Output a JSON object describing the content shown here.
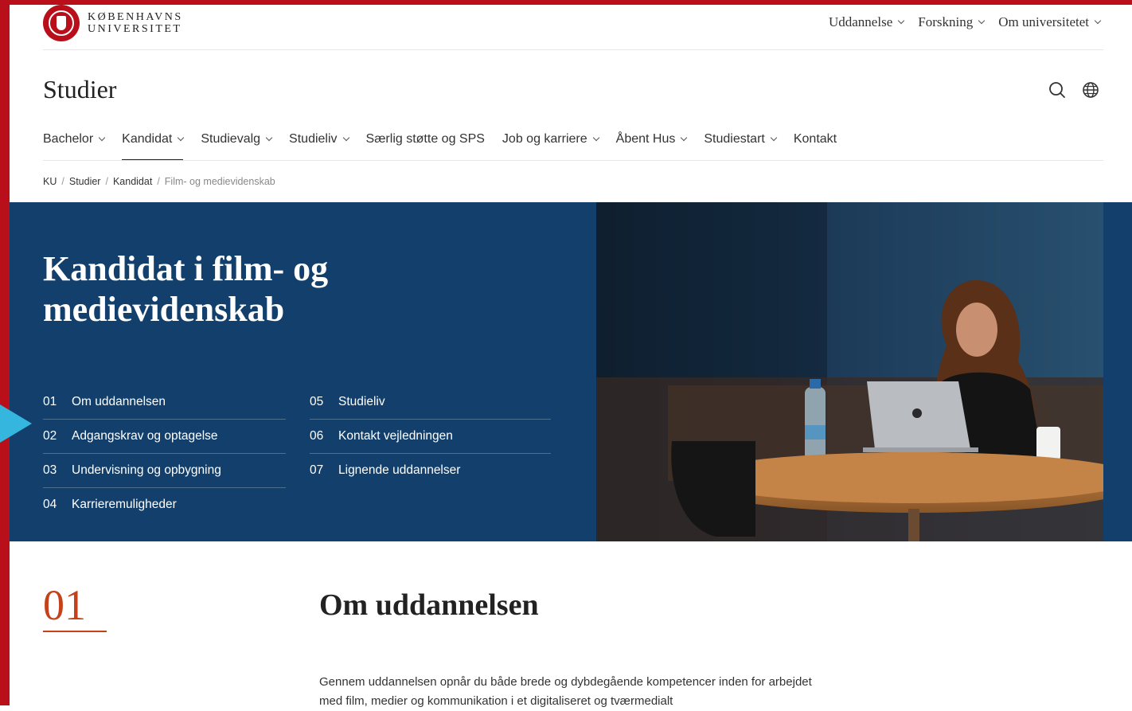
{
  "header": {
    "logo_line1": "KØBENHAVNS",
    "logo_line2": "UNIVERSITET",
    "topnav": [
      {
        "label": "Uddannelse"
      },
      {
        "label": "Forskning"
      },
      {
        "label": "Om universitetet"
      }
    ]
  },
  "site": {
    "title": "Studier"
  },
  "mainnav": [
    {
      "label": "Bachelor",
      "dropdown": true
    },
    {
      "label": "Kandidat",
      "dropdown": true,
      "active": true
    },
    {
      "label": "Studievalg",
      "dropdown": true
    },
    {
      "label": "Studieliv",
      "dropdown": true
    },
    {
      "label": "Særlig støtte og SPS",
      "dropdown": false
    },
    {
      "label": "Job og karriere",
      "dropdown": true
    },
    {
      "label": "Åbent Hus",
      "dropdown": true
    },
    {
      "label": "Studiestart",
      "dropdown": true
    },
    {
      "label": "Kontakt",
      "dropdown": false
    }
  ],
  "breadcrumb": {
    "items": [
      "KU",
      "Studier",
      "Kandidat"
    ],
    "current": "Film- og medievidenskab"
  },
  "hero": {
    "title": "Kandidat i film- og medievidenskab",
    "toc_left": [
      {
        "num": "01",
        "label": "Om uddannelsen"
      },
      {
        "num": "02",
        "label": "Adgangskrav og optagelse"
      },
      {
        "num": "03",
        "label": "Undervisning og opbygning"
      },
      {
        "num": "04",
        "label": "Karrieremuligheder"
      }
    ],
    "toc_right": [
      {
        "num": "05",
        "label": "Studieliv"
      },
      {
        "num": "06",
        "label": "Kontakt vejledningen"
      },
      {
        "num": "07",
        "label": "Lignende uddannelser"
      }
    ]
  },
  "section": {
    "num": "01",
    "title": "Om uddannelsen",
    "body": "Gennem uddannelsen opnår du både brede og dybdegående kompetencer inden for arbejdet med film, medier og kommunikation i et digitaliseret og tværmedialt"
  },
  "colors": {
    "brand_red": "#b80f1a",
    "hero_blue": "#123f6b",
    "accent_orange": "#c4411c",
    "highlight_cyan": "#35b6df"
  }
}
